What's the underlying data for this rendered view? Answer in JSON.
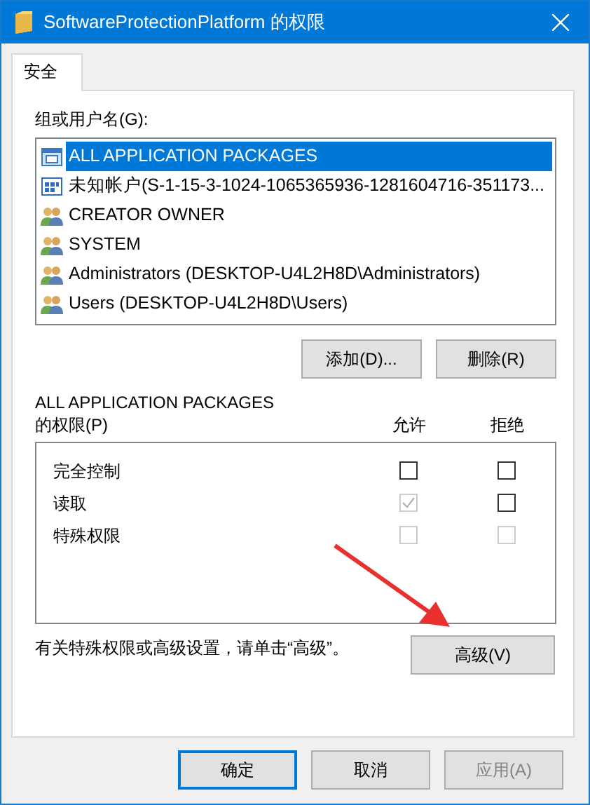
{
  "window": {
    "title": "SoftwareProtectionPlatform 的权限"
  },
  "tabs": [
    {
      "label": "安全",
      "selected": true
    }
  ],
  "groups": {
    "label": "组或用户名(G):",
    "items": [
      {
        "name": "ALL APPLICATION PACKAGES",
        "kind": "package",
        "selected": true
      },
      {
        "name": "未知帐户(S-1-15-3-1024-1065365936-1281604716-351173...",
        "kind": "unknown",
        "selected": false
      },
      {
        "name": "CREATOR OWNER",
        "kind": "users",
        "selected": false
      },
      {
        "name": "SYSTEM",
        "kind": "users",
        "selected": false
      },
      {
        "name": "Administrators (DESKTOP-U4L2H8D\\Administrators)",
        "kind": "users",
        "selected": false
      },
      {
        "name": "Users (DESKTOP-U4L2H8D\\Users)",
        "kind": "users",
        "selected": false
      }
    ]
  },
  "group_buttons": [
    "添加(D)...",
    "删除(R)"
  ],
  "permissions": {
    "title": "ALL APPLICATION PACKAGES",
    "subtitle": "的权限(P)",
    "columns": [
      "允许",
      "拒绝"
    ],
    "rows": [
      {
        "name": "完全控制",
        "allow": {
          "checked": false,
          "disabled": false
        },
        "deny": {
          "checked": false,
          "disabled": false
        }
      },
      {
        "name": "读取",
        "allow": {
          "checked": true,
          "disabled": true
        },
        "deny": {
          "checked": false,
          "disabled": false
        }
      },
      {
        "name": "特殊权限",
        "allow": {
          "checked": false,
          "disabled": true
        },
        "deny": {
          "checked": false,
          "disabled": true
        }
      }
    ]
  },
  "advanced": {
    "note": "有关特殊权限或高级设置，请单击“高级”。",
    "button": "高级(V)"
  },
  "buttons": [
    {
      "label": "确定",
      "default": true,
      "disabled": false
    },
    {
      "label": "取消",
      "default": false,
      "disabled": false
    },
    {
      "label": "应用(A)",
      "default": false,
      "disabled": true
    }
  ]
}
